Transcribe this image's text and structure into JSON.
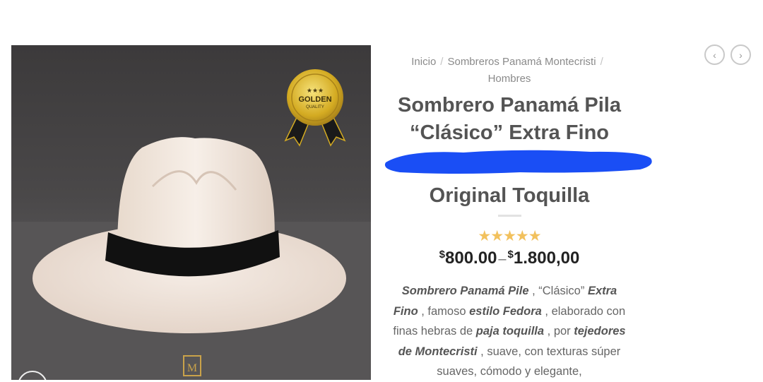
{
  "breadcrumb": {
    "home": "Inicio",
    "category": "Sombreros Panamá Montecristi",
    "subcategory": "Hombres"
  },
  "product": {
    "title_line1": "Sombrero Panamá Pila",
    "title_line2": "“Clásico” Extra Fino",
    "title_line4": "Original Toquilla",
    "stars": "★★★★★",
    "price_min_symbol": "$",
    "price_min": "800.00",
    "price_sep": "–",
    "price_max_symbol": "$",
    "price_max": "1.800,00",
    "desc": {
      "p1": "Sombrero Panamá Pile",
      "p2": " , “Clásico” ",
      "p3": "Extra Fino",
      "p4": " , famoso ",
      "p5": "estilo Fedora",
      "p6": " , elaborado con finas hebras de ",
      "p7": "paja toquilla",
      "p8": " , por ",
      "p9": "tejedores de Montecristi",
      "p10": " , suave, con texturas súper suaves, cómodo y elegante,"
    },
    "badge": {
      "line1": "★★★",
      "line2": "GOLDEN",
      "line3": "QUALITY"
    }
  },
  "nav": {
    "prev_icon": "‹",
    "next_icon": "›"
  },
  "colors": {
    "star": "#f2c15d",
    "scribble": "#1a4ef5",
    "badge_gold": "#d9b52c"
  }
}
